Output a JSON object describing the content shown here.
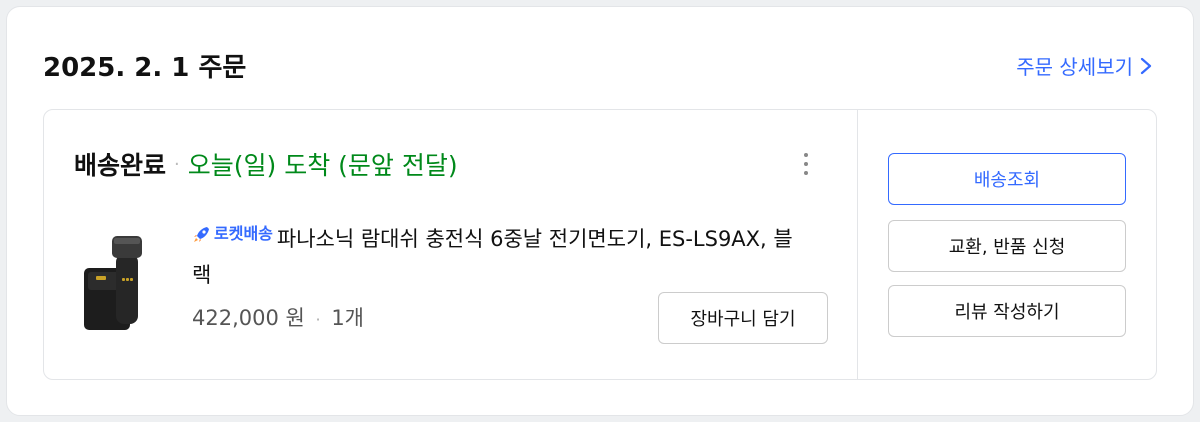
{
  "order": {
    "date_title": "2025. 2. 1 주문",
    "detail_link": "주문 상세보기"
  },
  "shipment": {
    "status": "배송완료",
    "separator": "·",
    "arrival": "오늘(일) 도착 (문앞 전달)"
  },
  "product": {
    "badge": "로켓배송",
    "name": "파나소닉 람대쉬 충전식 6중날 전기면도기, ES-LS9AX, 블랙",
    "price": "422,000 원",
    "price_separator": "·",
    "quantity": "1개",
    "cart_button": "장바구니 담기",
    "image_icon": "electric-shaver-icon"
  },
  "actions": {
    "track": "배송조회",
    "exchange_return": "교환, 반품 신청",
    "review": "리뷰 작성하기"
  },
  "colors": {
    "accent": "#346aff",
    "arrival_green": "#00891a"
  }
}
